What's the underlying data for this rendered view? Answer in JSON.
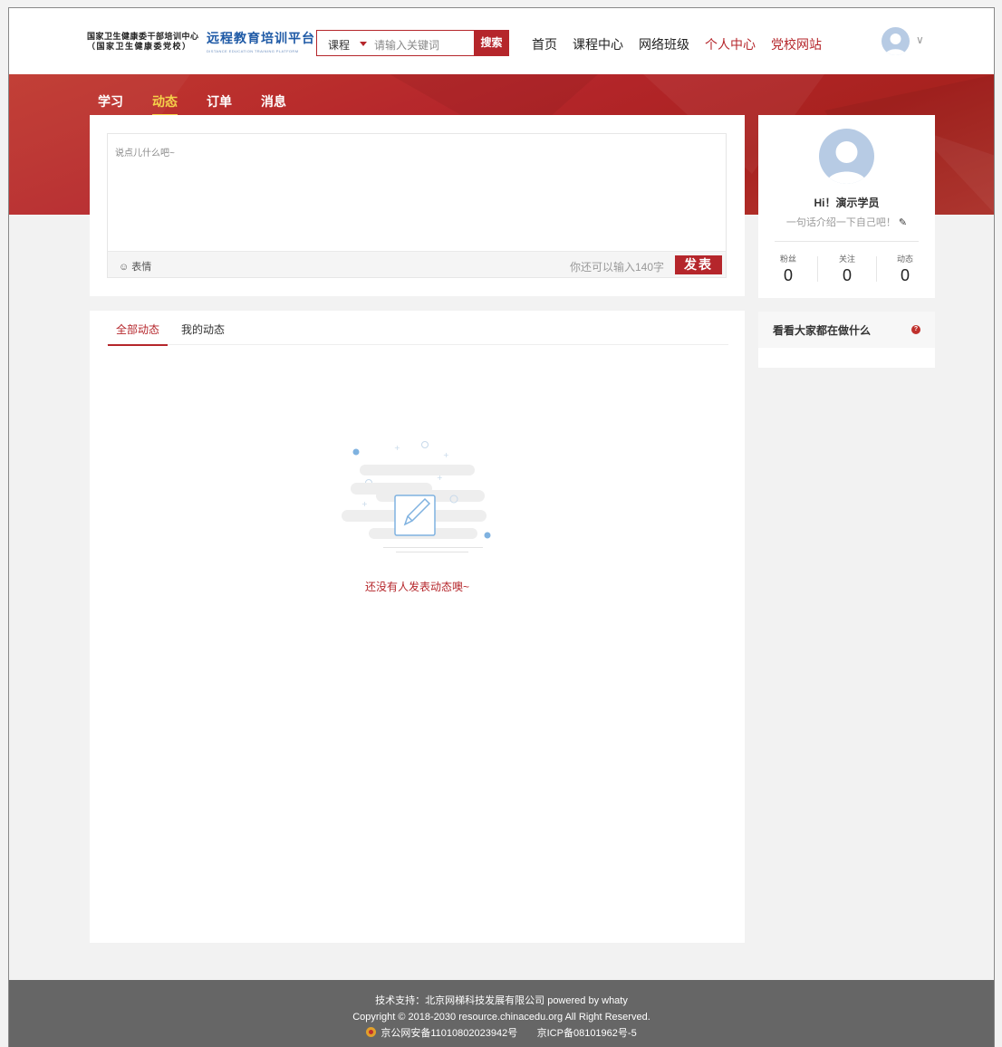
{
  "header": {
    "logo_line1": "国家卫生健康委干部培训中心",
    "logo_line2": "（国家卫生健康委党校）",
    "brand_cn": "远程教育培训平台",
    "brand_en": "DISTANCE EDUCATION TRAINING PLATFORM",
    "search_category": "课程",
    "search_placeholder": "请输入关键词",
    "search_button": "搜索",
    "nav": [
      "首页",
      "课程中心",
      "网络班级",
      "个人中心",
      "党校网站"
    ]
  },
  "tabs": [
    "学习",
    "动态",
    "订单",
    "消息"
  ],
  "post": {
    "placeholder": "说点儿什么吧~",
    "emoji_label": "表情",
    "remaining": "你还可以输入140字",
    "publish_button": "发表"
  },
  "profile": {
    "greeting": "Hi！演示学员",
    "intro": "一句话介绍一下自己吧！",
    "stats": [
      {
        "label": "粉丝",
        "value": "0"
      },
      {
        "label": "关注",
        "value": "0"
      },
      {
        "label": "动态",
        "value": "0"
      }
    ]
  },
  "feed": {
    "tabs": [
      "全部动态",
      "我的动态"
    ],
    "empty_text": "还没有人发表动态噢~"
  },
  "side": {
    "title": "看看大家都在做什么"
  },
  "footer": {
    "line1": "技术支持：北京网梯科技发展有限公司 powered by whaty",
    "line2": "Copyright © 2018-2030 resource.chinacedu.org All Right Reserved.",
    "police_record": "京公网安备11010802023942号",
    "icp": "京ICP备08101962号-5"
  },
  "colors": {
    "brand_red": "#b5262b",
    "active_tab": "#f5d24a",
    "brand_blue": "#1f5aa6"
  }
}
